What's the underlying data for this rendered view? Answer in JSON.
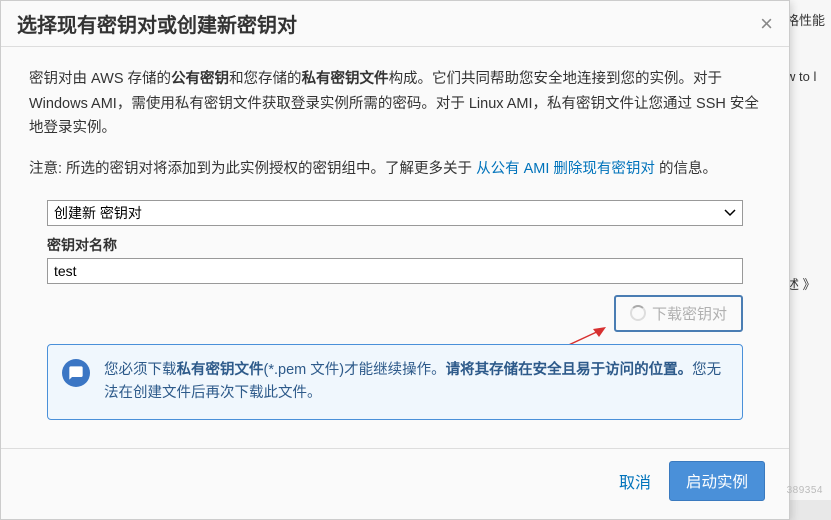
{
  "dialog": {
    "title": "选择现有密钥对或创建新密钥对",
    "description": {
      "p1_pre": "密钥对由 AWS 存储的",
      "p1_b1": "公有密钥",
      "p1_mid1": "和您存储的",
      "p1_b2": "私有密钥文件",
      "p1_mid2": "构成。它们共同帮助您安全地连接到您的实例。对于 Windows AMI，需使用私有密钥文件获取登录实例所需的密码。对于 Linux AMI，私有密钥文件让您通过 SSH 安全地登录实例。"
    },
    "note": {
      "pre": "注意: 所选的密钥对将添加到为此实例授权的密钥组中。了解更多关于 ",
      "link": "从公有 AMI 删除现有密钥对",
      "post": " 的信息。"
    },
    "form": {
      "select_value": "创建新 密钥对",
      "name_label": "密钥对名称",
      "name_value": "test"
    },
    "download_button": "下载密钥对",
    "notice": {
      "pre": "您必须下载",
      "b1": "私有密钥文件",
      "mid1": "(*.pem 文件)才能继续操作。",
      "emph": "请将其存储在安全且易于访问的位置。",
      "post": "您无法在创建文件后再次下载此文件。"
    },
    "footer": {
      "cancel": "取消",
      "confirm": "启动实例"
    }
  },
  "background": {
    "item1": "格性能",
    "item2": "w to l",
    "item3": "述 》"
  },
  "watermark": "389354"
}
